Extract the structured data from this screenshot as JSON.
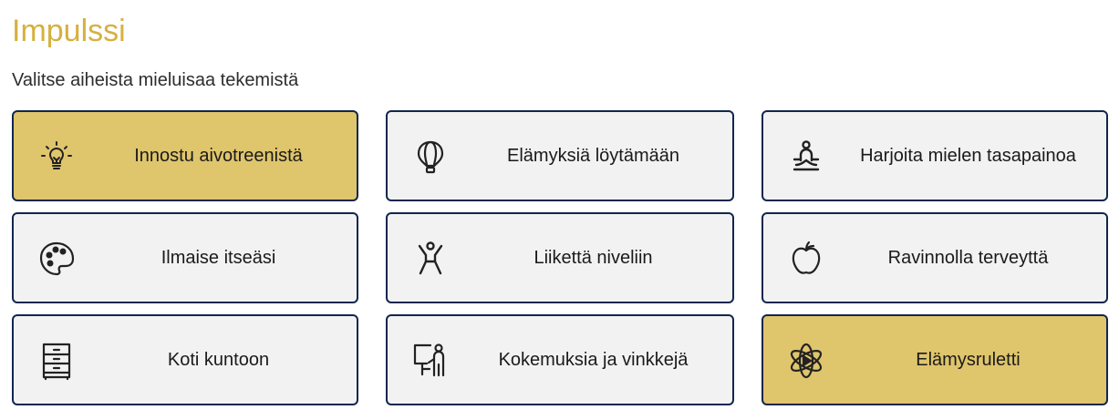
{
  "page": {
    "title": "Impulssi",
    "subtitle": "Valitse aiheista mieluisaa tekemistä"
  },
  "tiles": [
    {
      "label": "Innostu aivotreenistä",
      "icon": "lightbulb-icon",
      "highlighted": true
    },
    {
      "label": "Elämyksiä löytämään",
      "icon": "hot-air-balloon-icon",
      "highlighted": false
    },
    {
      "label": "Harjoita mielen tasapainoa",
      "icon": "meditation-icon",
      "highlighted": false
    },
    {
      "label": "Ilmaise itseäsi",
      "icon": "palette-icon",
      "highlighted": false
    },
    {
      "label": "Liikettä niveliin",
      "icon": "jumping-person-icon",
      "highlighted": false
    },
    {
      "label": "Ravinnolla terveyttä",
      "icon": "apple-icon",
      "highlighted": false
    },
    {
      "label": "Koti kuntoon",
      "icon": "drawer-cabinet-icon",
      "highlighted": false
    },
    {
      "label": "Kokemuksia ja vinkkejä",
      "icon": "presenter-icon",
      "highlighted": false
    },
    {
      "label": "Elämysruletti",
      "icon": "atom-play-icon",
      "highlighted": true
    }
  ],
  "colors": {
    "title": "#d5b13f",
    "tile_highlight": "#dfc56c",
    "tile_default": "#f2f2f2",
    "tile_border": "#11264f"
  }
}
